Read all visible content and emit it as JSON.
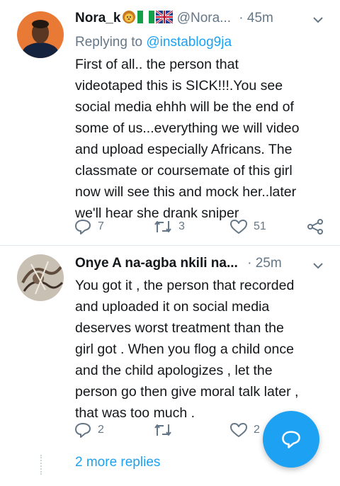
{
  "tweets": [
    {
      "name": "Nora_k",
      "handle": "@Nora...",
      "time": "· 45m",
      "replying_prefix": "Replying to ",
      "replying_mention": "@instablog9ja",
      "body_lines": [
        "First of all.. the person that",
        "videotaped this is SICK!!!.You see",
        "social media ehhh will be the end of",
        "some of us...everything we will video",
        "and upload especially Africans. The",
        "classmate or coursemate of this girl",
        "now will see this and mock her..later",
        "we'll hear she drank sniper"
      ],
      "reply_count": "7",
      "retweet_count": "3",
      "like_count": "51",
      "icons": [
        "lion-emoji",
        "nigeria-flag",
        "uk-flag",
        "chevron-down-icon"
      ]
    },
    {
      "name": "Onye A na-agba nkili na...",
      "time": "· 25m",
      "body_lines": [
        "You got it , the person that recorded",
        "and uploaded it on social media",
        "deserves worst treatment than the",
        "girl got .  When you flog a child once",
        "and the child apologizes , let the",
        "person go then give moral talk later ,",
        "that was too much ."
      ],
      "reply_count": "2",
      "like_count": "2"
    }
  ],
  "more_replies": "2 more replies",
  "colors": {
    "accent": "#1da1f2",
    "muted": "#657786",
    "text": "#14171a",
    "divider": "#e1e8ed"
  }
}
